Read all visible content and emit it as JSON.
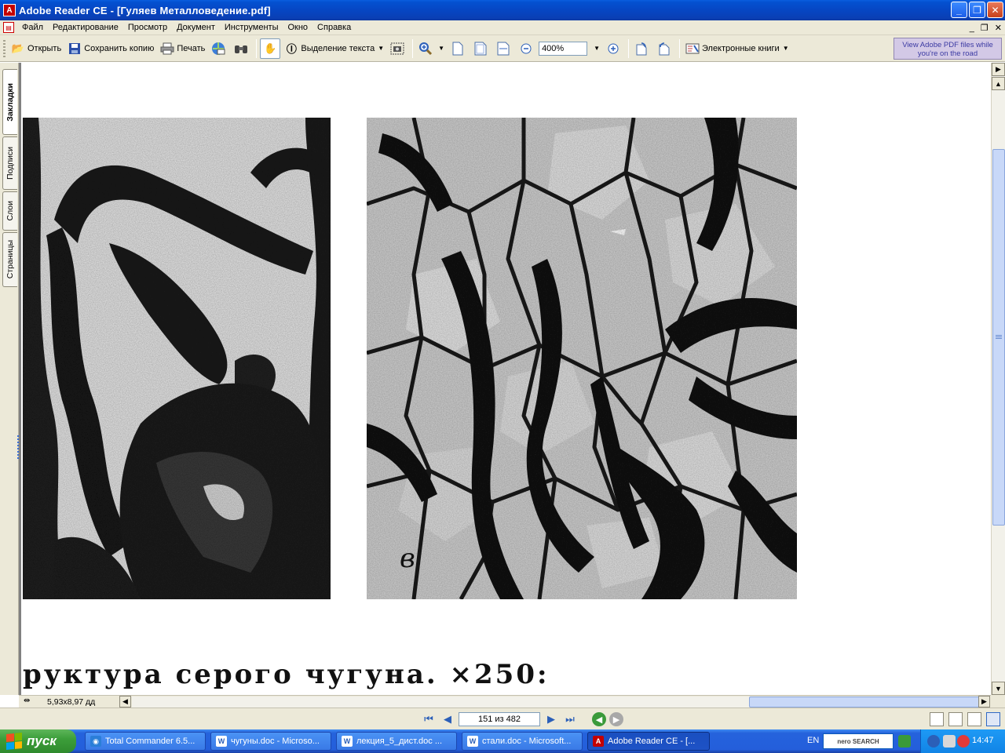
{
  "window": {
    "title": "Adobe Reader CE - [Гуляев Металловедение.pdf]",
    "app_icon_text": "A",
    "min": "_",
    "max": "❐",
    "close": "✕"
  },
  "menu": {
    "items": [
      "Файл",
      "Редактирование",
      "Просмотр",
      "Документ",
      "Инструменты",
      "Окно",
      "Справка"
    ],
    "mdi_min": "_",
    "mdi_restore": "❐",
    "mdi_close": "✕"
  },
  "toolbar": {
    "open": "Открыть",
    "save_copy": "Сохранить копию",
    "print": "Печать",
    "select_text": "Выделение текста",
    "zoom_value": "400%",
    "ebooks": "Электронные книги",
    "banner_line1": "View Adobe PDF files while",
    "banner_line2": "you're on the road"
  },
  "nav_tabs": [
    "Закладки",
    "Подписи",
    "Слои",
    "Страницы"
  ],
  "document": {
    "caption": "руктура серого чугуна. ×250:",
    "figure_letter": "в"
  },
  "statusbar": {
    "page_size": "5,93x8,97 дд",
    "page_indicator": "151 из 482"
  },
  "taskbar": {
    "start": "пуск",
    "tasks": [
      {
        "label": "Total Commander 6.5...",
        "icon_color": "#2a7ed8",
        "icon_text": "◉"
      },
      {
        "label": "чугуны.doc - Microso...",
        "icon_color": "#2b5fb8",
        "icon_text": "W"
      },
      {
        "label": "лекция_5_дист.doc ...",
        "icon_color": "#2b5fb8",
        "icon_text": "W"
      },
      {
        "label": "стали.doc - Microsoft...",
        "icon_color": "#2b5fb8",
        "icon_text": "W"
      },
      {
        "label": "Adobe Reader CE - [...",
        "icon_color": "#c40000",
        "icon_text": "A"
      }
    ],
    "lang": "EN",
    "nero": "nero SEARCH",
    "clock": "14:47"
  }
}
